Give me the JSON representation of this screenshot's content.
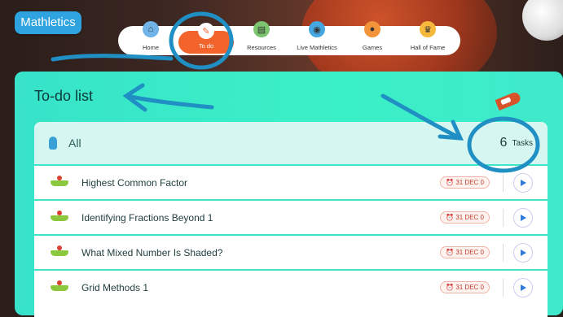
{
  "app": {
    "logo_text": "Mathletics"
  },
  "nav": {
    "items": [
      {
        "label": "Home",
        "icon": "home-icon"
      },
      {
        "label": "To do",
        "icon": "pencil-icon"
      },
      {
        "label": "Resources",
        "icon": "resources-icon"
      },
      {
        "label": "Live Mathletics",
        "icon": "globe-icon"
      },
      {
        "label": "Games",
        "icon": "ball-icon"
      },
      {
        "label": "Hall of Fame",
        "icon": "trophy-icon"
      }
    ]
  },
  "panel": {
    "title": "To-do list"
  },
  "list": {
    "filter_label": "All",
    "count": "6",
    "count_label": "Tasks",
    "tasks": [
      {
        "name": "Highest Common Factor",
        "due": "31 DEC 0"
      },
      {
        "name": "Identifying Fractions Beyond 1",
        "due": "31 DEC 0"
      },
      {
        "name": "What Mixed Number Is Shaded?",
        "due": "31 DEC 0"
      },
      {
        "name": "Grid Methods 1",
        "due": "31 DEC 0"
      }
    ]
  },
  "colors": {
    "accent": "#f2642c",
    "panel": "#3af0c6",
    "play": "#2f7bd9"
  }
}
